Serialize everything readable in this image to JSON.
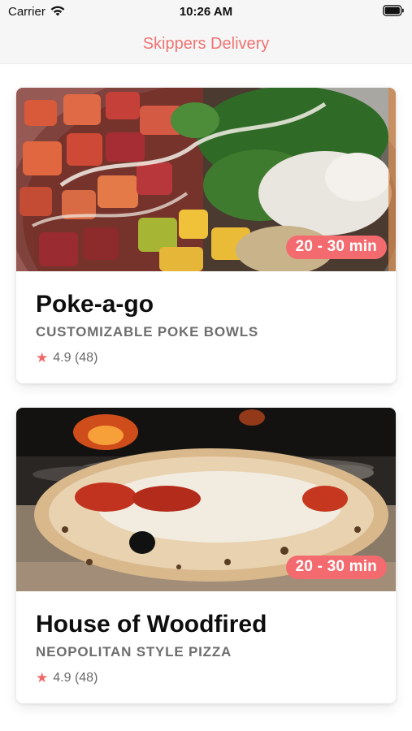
{
  "status_bar": {
    "carrier": "Carrier",
    "time": "10:26 AM"
  },
  "nav": {
    "title": "Skippers Delivery",
    "accent_color": "#f07474"
  },
  "restaurants": [
    {
      "name": "Poke-a-go",
      "subtitle": "CUSTOMIZABLE POKE BOWLS",
      "rating": "4.9 (48)",
      "delivery_time": "20 - 30 min",
      "image": "poke-bowl-photo"
    },
    {
      "name": "House of Woodfired",
      "subtitle": "NEOPOLITAN STYLE PIZZA",
      "rating": "4.9 (48)",
      "delivery_time": "20 - 30 min",
      "image": "woodfired-pizza-photo"
    }
  ],
  "icons": {
    "rating": "star-icon",
    "network": "wifi-icon",
    "power": "battery-icon"
  },
  "badge_color": "#f36b6f"
}
